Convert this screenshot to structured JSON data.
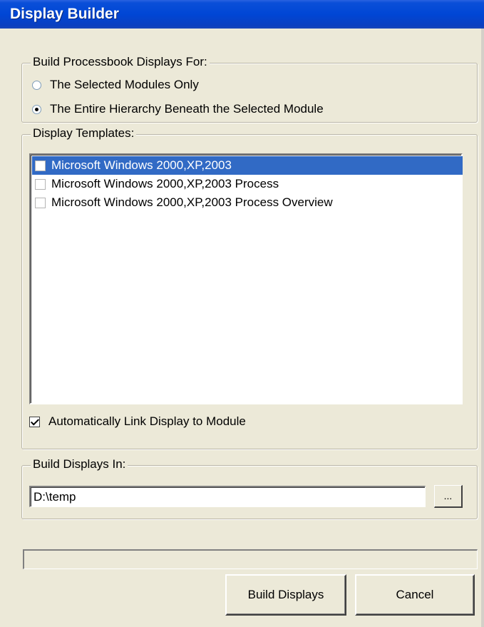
{
  "window": {
    "title": "Display Builder"
  },
  "build_for": {
    "legend": "Build Processbook Displays For:",
    "options": [
      {
        "label": "The Selected Modules Only",
        "checked": false
      },
      {
        "label": "The Entire Hierarchy Beneath the Selected Module",
        "checked": true
      }
    ]
  },
  "templates": {
    "legend": "Display Templates:",
    "items": [
      {
        "label": "Microsoft Windows 2000,XP,2003",
        "selected": true,
        "checked": false
      },
      {
        "label": "Microsoft Windows 2000,XP,2003 Process",
        "selected": false,
        "checked": false
      },
      {
        "label": "Microsoft Windows 2000,XP,2003 Process Overview",
        "selected": false,
        "checked": false
      }
    ],
    "auto_link": {
      "label": "Automatically Link Display to Module",
      "checked": true
    }
  },
  "build_in": {
    "legend": "Build Displays In:",
    "path_value": "D:\\temp",
    "browse_label": "..."
  },
  "progress": {
    "fraction": 0
  },
  "buttons": {
    "build_label": "Build Displays",
    "cancel_label": "Cancel"
  },
  "colors": {
    "titlebar": "#0046d5",
    "dialog_bg": "#ece9d8",
    "selection": "#316ac5"
  }
}
